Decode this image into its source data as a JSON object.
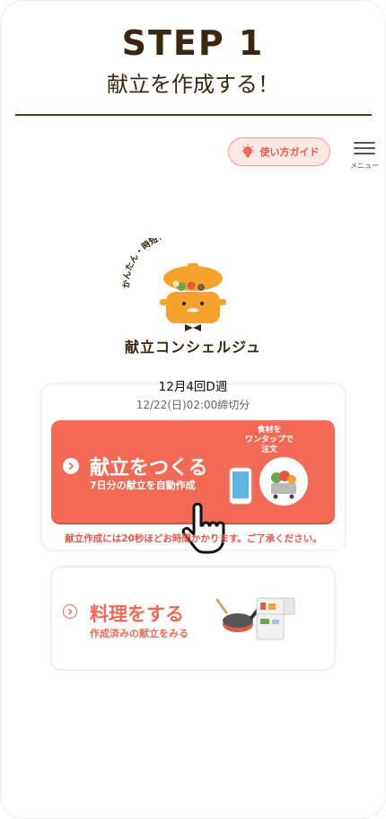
{
  "header": {
    "step": "STEP 1",
    "subtitle": "献立を作成する！"
  },
  "toolbar": {
    "guide_label": "使い方ガイド",
    "menu_label": "メニュー"
  },
  "logo": {
    "tagline": "かんたん・時短！まるっと提案。",
    "name": "献立コンシェルジュ"
  },
  "week_card": {
    "week_label": "12月4回D週",
    "deadline": "12/22(日)02:00締切分",
    "make_button": {
      "title": "献立をつくる",
      "subtitle": "7日分の献立を自動作成",
      "order_line1": "食材を",
      "order_line2": "ワンタップで",
      "order_line3": "注文"
    },
    "note": "献立作成には20秒ほどお時間かかります。ご了承ください。"
  },
  "cook_button": {
    "title": "料理をする",
    "subtitle": "作成済みの献立をみる"
  },
  "colors": {
    "accent": "#f26a55",
    "brown": "#3b2710",
    "pot_orange": "#f5a32c"
  }
}
